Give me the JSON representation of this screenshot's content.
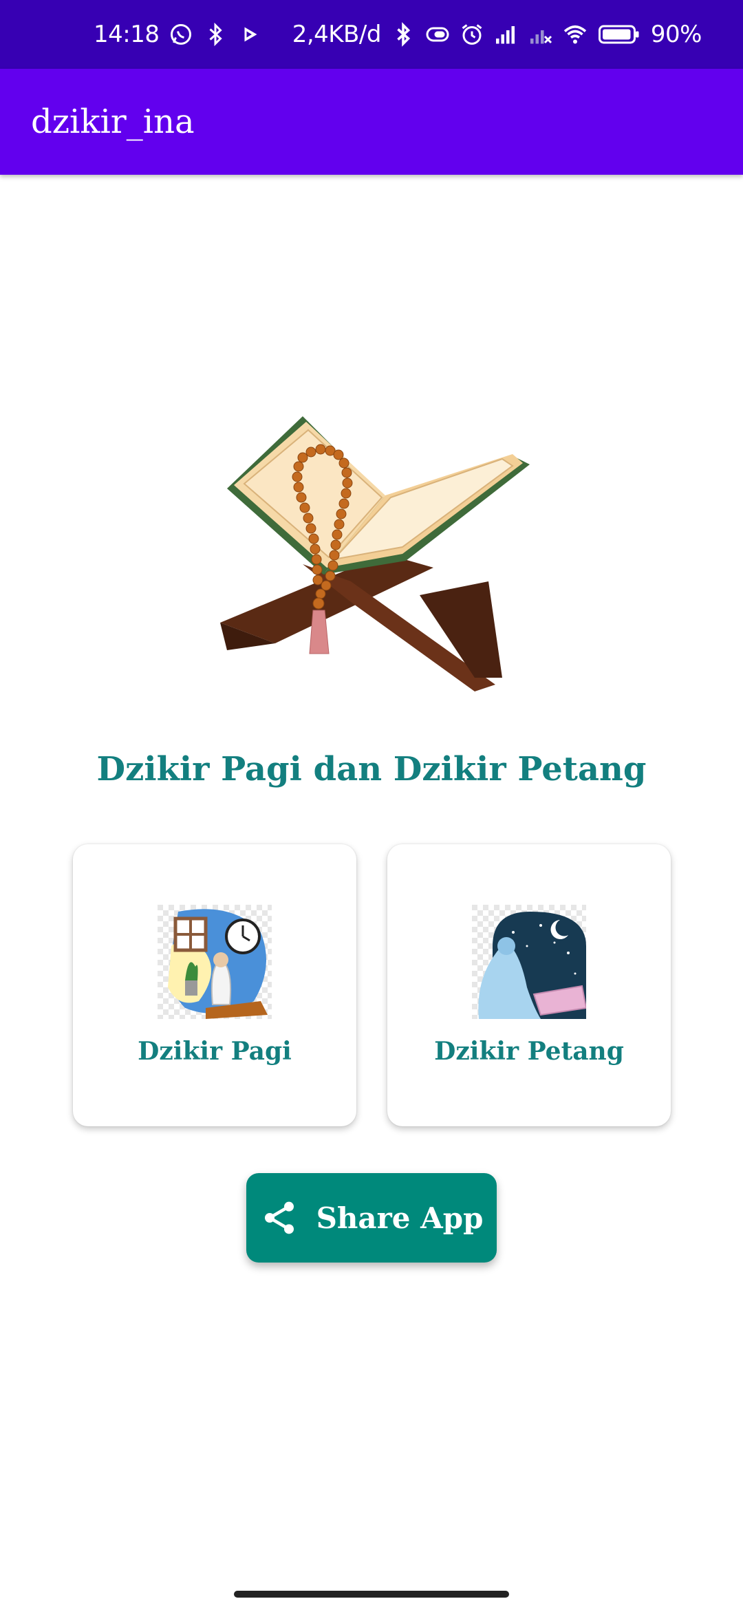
{
  "status_bar": {
    "time": "14:18",
    "network_speed": "2,4KB/d",
    "battery_percent": "90%",
    "icons_left": [
      "whatsapp-icon",
      "bluetooth-icon",
      "play-icon"
    ],
    "icons_right": [
      "bluetooth-icon",
      "battery-saver-icon",
      "alarm-icon",
      "signal-icon",
      "signal-off-icon",
      "wifi-icon",
      "battery-icon"
    ]
  },
  "app_bar": {
    "title": "dzikir_ina",
    "color": "#6200ee"
  },
  "hero": {
    "icon": "quran-stand-with-prayer-beads"
  },
  "headline": "Dzikir Pagi dan Dzikir Petang",
  "cards": [
    {
      "label": "Dzikir Pagi",
      "icon": "morning-prayer-illustration"
    },
    {
      "label": "Dzikir Petang",
      "icon": "evening-prayer-illustration"
    }
  ],
  "share_button": {
    "label": "Share App",
    "icon": "share-icon",
    "color": "#00897b"
  },
  "colors": {
    "status_bar": "#3700b3",
    "accent_text": "#137f7f"
  }
}
